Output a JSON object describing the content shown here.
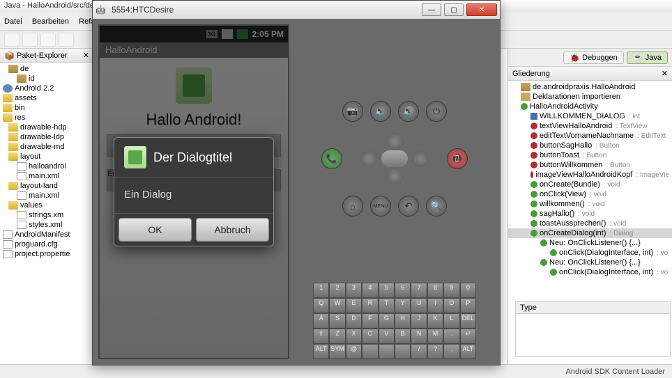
{
  "eclipse": {
    "title": "Java - HalloAndroid/src/de",
    "menu": [
      "Datei",
      "Bearbeiten",
      "Refac"
    ],
    "left_tab": "Paket-Explorer",
    "perspectives": {
      "debug": "Debuggen",
      "java": "Java"
    },
    "outline_tab": "Gliederung",
    "status": "Android SDK Content Loader",
    "bottom_header": "Type"
  },
  "pkg_tree": [
    {
      "l": 1,
      "t": "de"
    },
    {
      "l": 2,
      "t": "id"
    },
    {
      "l": 0,
      "t": "Android 2.2",
      "ic": "ic-java"
    },
    {
      "l": 0,
      "t": "assets",
      "ic": "ic-folder"
    },
    {
      "l": 0,
      "t": "bin",
      "ic": "ic-folder"
    },
    {
      "l": 0,
      "t": "res",
      "ic": "ic-folder"
    },
    {
      "l": 1,
      "t": "drawable-hdp",
      "ic": "ic-folder"
    },
    {
      "l": 1,
      "t": "drawable-ldp",
      "ic": "ic-folder"
    },
    {
      "l": 1,
      "t": "drawable-md",
      "ic": "ic-folder"
    },
    {
      "l": 1,
      "t": "layout",
      "ic": "ic-folder"
    },
    {
      "l": 2,
      "t": "halloandroi",
      "ic": "ic-file"
    },
    {
      "l": 2,
      "t": "main.xml",
      "ic": "ic-file"
    },
    {
      "l": 1,
      "t": "layout-land",
      "ic": "ic-folder"
    },
    {
      "l": 2,
      "t": "main.xml",
      "ic": "ic-file"
    },
    {
      "l": 1,
      "t": "values",
      "ic": "ic-folder"
    },
    {
      "l": 2,
      "t": "strings.xm",
      "ic": "ic-file"
    },
    {
      "l": 2,
      "t": "styles.xml",
      "ic": "ic-file"
    },
    {
      "l": 0,
      "t": "AndroidManifest",
      "ic": "ic-file"
    },
    {
      "l": 0,
      "t": "proguard.cfg",
      "ic": "ic-file"
    },
    {
      "l": 0,
      "t": "project.propertie",
      "ic": "ic-file"
    }
  ],
  "outline": [
    {
      "l": 1,
      "t": "de.androidpraxis.HalloAndroid",
      "d": "pkg"
    },
    {
      "l": 1,
      "t": "Deklarationen importieren",
      "d": "imp"
    },
    {
      "l": 1,
      "t": "HalloAndroidActivity",
      "d": "class"
    },
    {
      "l": 2,
      "t": "WILLKOMMEN_DIALOG",
      "ty": "int",
      "d": "sf"
    },
    {
      "l": 2,
      "t": "textViewHalloAndroid",
      "ty": "TextView",
      "d": "f"
    },
    {
      "l": 2,
      "t": "editTextVornameNachname",
      "ty": "EditText",
      "d": "f"
    },
    {
      "l": 2,
      "t": "buttonSagHallo",
      "ty": "Button",
      "d": "f"
    },
    {
      "l": 2,
      "t": "buttonToast",
      "ty": "Button",
      "d": "f"
    },
    {
      "l": 2,
      "t": "buttonWillkommen",
      "ty": "Button",
      "d": "f"
    },
    {
      "l": 2,
      "t": "imageViewHalloAndroidKopf",
      "ty": "ImageVie",
      "d": "f"
    },
    {
      "l": 2,
      "t": "onCreate(Bundle)",
      "ty": "void",
      "d": "m"
    },
    {
      "l": 2,
      "t": "onClick(View)",
      "ty": "void",
      "d": "m"
    },
    {
      "l": 2,
      "t": "willkommen()",
      "ty": "void",
      "d": "m"
    },
    {
      "l": 2,
      "t": "sagHallo()",
      "ty": "void",
      "d": "m"
    },
    {
      "l": 2,
      "t": "toastAussprechen()",
      "ty": "void",
      "d": "m"
    },
    {
      "l": 2,
      "t": "onCreateDialog(int)",
      "ty": "Dialog",
      "d": "m",
      "sel": true
    },
    {
      "l": 3,
      "t": "Neu: OnClickListener() {...}",
      "d": "anon"
    },
    {
      "l": 4,
      "t": "onClick(DialogInterface, int)",
      "ty": "vo",
      "d": "m"
    },
    {
      "l": 3,
      "t": "Neu: OnClickListener() {...}",
      "d": "anon"
    },
    {
      "l": 4,
      "t": "onClick(DialogInterface, int)",
      "ty": "vo",
      "d": "m"
    }
  ],
  "emulator": {
    "window_title": "5554:HTCDesire",
    "status_time": "2:05 PM",
    "status_3g": "3G",
    "app_title": "HalloAndroid",
    "app_heading": "Hallo Android!"
  },
  "dialog": {
    "title": "Der Dialogtitel",
    "message": "Ein Dialog",
    "ok": "OK",
    "cancel": "Abbruch"
  },
  "hw": {
    "camera": "📷",
    "vol_down": "🔉",
    "vol_up": "🔊",
    "power": "⏻",
    "call": "📞",
    "end": "📵",
    "home": "⌂",
    "menu": "MENU",
    "back": "↶",
    "search": "🔍"
  },
  "keyboard": [
    [
      "1",
      "2",
      "3",
      "4",
      "5",
      "6",
      "7",
      "8",
      "9",
      "0"
    ],
    [
      "Q",
      "W",
      "E",
      "R",
      "T",
      "Y",
      "U",
      "I",
      "O",
      "P"
    ],
    [
      "A",
      "S",
      "D",
      "F",
      "G",
      "H",
      "J",
      "K",
      "L",
      "DEL"
    ],
    [
      "⇧",
      "Z",
      "X",
      "C",
      "V",
      "B",
      "N",
      "M",
      ".",
      "↵"
    ],
    [
      "ALT",
      "SYM",
      "@",
      "",
      "",
      "",
      "/",
      "?",
      ",",
      "ALT"
    ]
  ]
}
